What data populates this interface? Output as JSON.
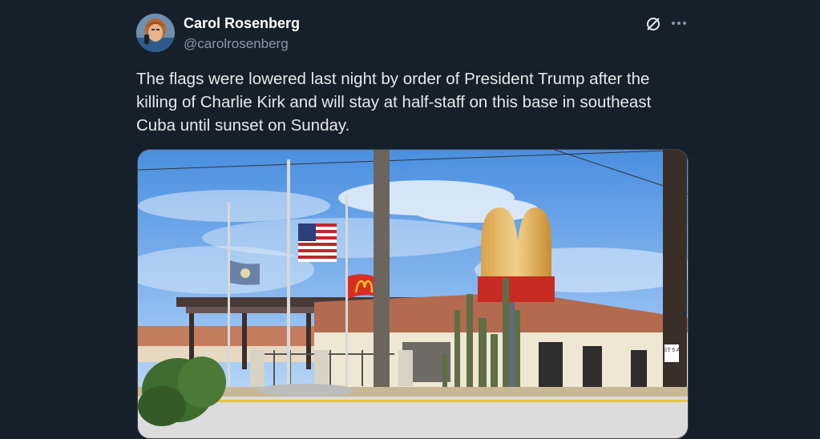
{
  "author": {
    "name": "Carol Rosenberg",
    "handle": "@carolrosenberg"
  },
  "tweet": {
    "text": "The flags were lowered last night by order of President Trump after the killing of Charlie Kirk and will stay at half-staff on this base in southeast Cuba until sunset on Sunday."
  },
  "icons": {
    "grok": "grok-icon",
    "more": "more-icon"
  },
  "photo": {
    "street_sign": "ST 5 A"
  },
  "colors": {
    "background": "#15202b",
    "text": "#e7e9ea",
    "secondary": "#8b98a5"
  }
}
